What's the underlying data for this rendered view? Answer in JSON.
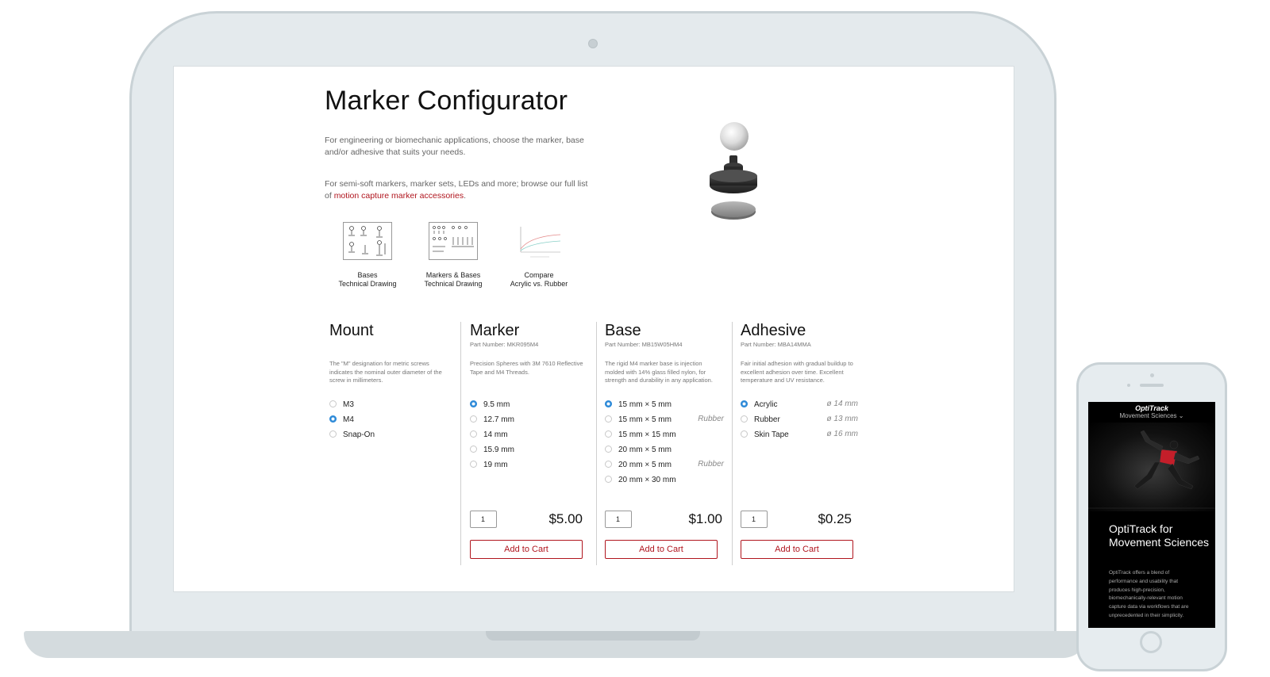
{
  "page": {
    "title": "Marker Configurator",
    "intro_1": "For engineering or biomechanic applications, choose the marker, base and/or adhesive that suits your needs.",
    "intro_2_prefix": "For semi-soft markers, marker sets, LEDs and more; browse our full list of ",
    "intro_2_link": "motion capture marker accessories",
    "intro_2_suffix": "."
  },
  "docs": [
    {
      "line1": "Bases",
      "line2": "Technical Drawing"
    },
    {
      "line1": "Markers & Bases",
      "line2": "Technical Drawing"
    },
    {
      "line1": "Compare",
      "line2": "Acrylic vs. Rubber"
    }
  ],
  "mount": {
    "title": "Mount",
    "description": "The \"M\" designation for metric screws indicates the nominal outer diameter of the screw in millimeters.",
    "options": [
      "M3",
      "M4",
      "Snap-On"
    ],
    "selected": 1
  },
  "marker": {
    "title": "Marker",
    "part_number": "Part Number: MKR095M4",
    "description": "Precision Spheres with 3M 7610 Reflective Tape and M4 Threads.",
    "options": [
      "9.5 mm",
      "12.7 mm",
      "14 mm",
      "15.9 mm",
      "19 mm"
    ],
    "selected": 0,
    "qty": "1",
    "price": "$5.00",
    "cart_label": "Add to Cart"
  },
  "base": {
    "title": "Base",
    "part_number": "Part Number: MB15W05HM4",
    "description": "The rigid M4 marker base is injection molded with 14% glass filled nylon, for strength and durability in any application.",
    "options": [
      "15 mm × 5 mm",
      "15 mm × 5 mm",
      "15 mm × 15 mm",
      "20 mm × 5 mm",
      "20 mm × 5 mm",
      "20 mm × 30 mm"
    ],
    "notes": [
      "",
      "Rubber",
      "",
      "",
      "Rubber",
      ""
    ],
    "selected": 0,
    "qty": "1",
    "price": "$1.00",
    "cart_label": "Add to Cart"
  },
  "adhesive": {
    "title": "Adhesive",
    "part_number": "Part Number: MBA14MMA",
    "description": "Fair initial adhesion with gradual buildup to excellent adhesion over time. Excellent temperature and UV resistance.",
    "options": [
      "Acrylic",
      "Rubber",
      "Skin Tape"
    ],
    "notes": [
      "ø 14 mm",
      "ø 13 mm",
      "ø 16 mm"
    ],
    "selected": 0,
    "qty": "1",
    "price": "$0.25",
    "cart_label": "Add to Cart"
  },
  "phone": {
    "brand": "OptiTrack",
    "nav": "Movement Sciences ⌄",
    "title": "OptiTrack for Movement Sciences",
    "body": "OptiTrack offers a blend of performance and usability that produces high-precision, biomechanically-relevant motion capture data via workflows that are unprecedented in their simplicity."
  },
  "colors": {
    "accent": "#b0151e",
    "radio_selected": "#2d8ad8"
  }
}
